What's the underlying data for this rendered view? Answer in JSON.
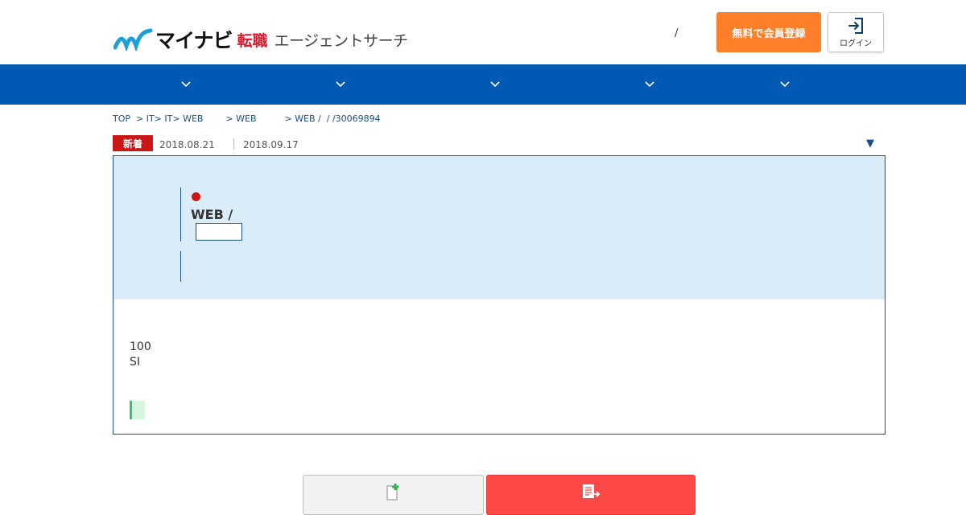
{
  "header": {
    "logo_main": "マイナビ",
    "logo_red": "転職",
    "logo_sub": "エージェントサーチ",
    "slash": "/",
    "register_label": "無料で会員登録",
    "login_label": "ログイン"
  },
  "nav": {
    "items": [
      "chevron-down-icon",
      "chevron-down-icon",
      "chevron-down-icon",
      "chevron-down-icon",
      "chevron-down-icon"
    ]
  },
  "breadcrumb": {
    "text": "TOP  > IT> IT> WEB        > WEB          > WEB /  / /30069894"
  },
  "meta": {
    "badge": "新着",
    "date_posted": "2018.08.21",
    "date_updated": "2018.09.17",
    "toggle": "▼"
  },
  "job": {
    "title": "WEB /",
    "body_line1": "100",
    "body_line2": "SI"
  },
  "colors": {
    "nav": "#0059b3",
    "register": "#ff7e2a",
    "apply": "#ff4848",
    "badge": "#cc1515",
    "panel": "#daecf7"
  }
}
